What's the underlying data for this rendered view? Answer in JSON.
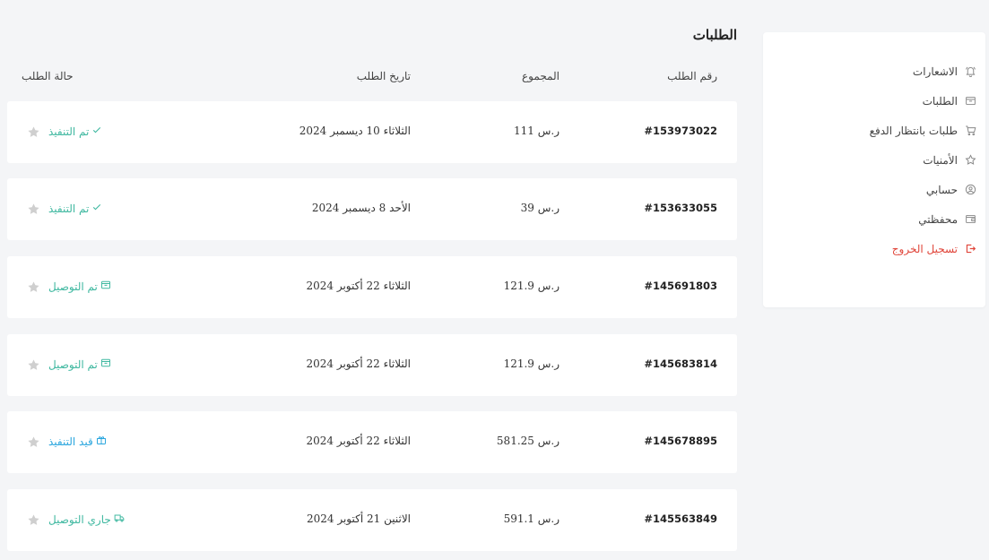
{
  "sidebar": {
    "items": [
      {
        "label": "الاشعارات",
        "icon": "bell-icon"
      },
      {
        "label": "الطلبات",
        "icon": "box-icon"
      },
      {
        "label": "طلبات بانتظار الدفع",
        "icon": "cart-icon"
      },
      {
        "label": "الأمنيات",
        "icon": "star-outline-icon"
      },
      {
        "label": "حسابي",
        "icon": "user-circle-icon"
      },
      {
        "label": "محفظتي",
        "icon": "wallet-icon"
      },
      {
        "label": "تسجيل الخروج",
        "icon": "logout-icon"
      }
    ]
  },
  "main": {
    "title": "الطلبات",
    "columns": {
      "order_number": "رقم الطلب",
      "total": "المجموع",
      "date": "تاريخ الطلب",
      "status": "حالة الطلب"
    },
    "orders": [
      {
        "number": "#153973022",
        "total": "111 ر.س",
        "date": "الثلاثاء 10 ديسمبر 2024",
        "status": "تم التنفيذ",
        "status_icon": "check-icon",
        "status_color": "#3fb8a0"
      },
      {
        "number": "#153633055",
        "total": "39 ر.س",
        "date": "الأحد 8 ديسمبر 2024",
        "status": "تم التنفيذ",
        "status_icon": "check-icon",
        "status_color": "#3fb8a0"
      },
      {
        "number": "#145691803",
        "total": "121.9 ر.س",
        "date": "الثلاثاء 22 أكتوبر 2024",
        "status": "تم التوصيل",
        "status_icon": "box-icon",
        "status_color": "#3fb8a0"
      },
      {
        "number": "#145683814",
        "total": "121.9 ر.س",
        "date": "الثلاثاء 22 أكتوبر 2024",
        "status": "تم التوصيل",
        "status_icon": "box-icon",
        "status_color": "#3fb8a0"
      },
      {
        "number": "#145678895",
        "total": "581.25 ر.س",
        "date": "الثلاثاء 22 أكتوبر 2024",
        "status": "قيد التنفيذ",
        "status_icon": "gift-icon",
        "status_color": "#2aa6de"
      },
      {
        "number": "#145563849",
        "total": "591.1 ر.س",
        "date": "الاثنين 21 أكتوبر 2024",
        "status": "جاري التوصيل",
        "status_icon": "truck-icon",
        "status_color": "#3fb8a0"
      }
    ]
  },
  "colors": {
    "background": "#f4f5f7",
    "card": "#ffffff",
    "logout": "#e0453a",
    "success": "#3fb8a0",
    "processing": "#2aa6de",
    "star": "#cfcfcf"
  }
}
